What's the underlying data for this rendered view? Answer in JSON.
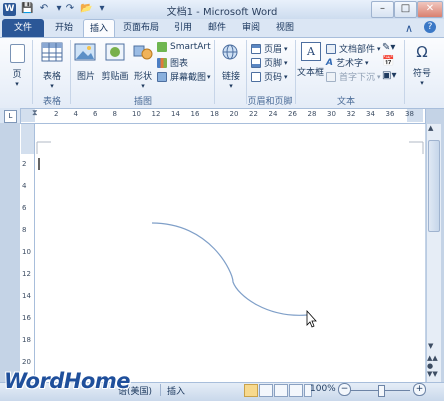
{
  "window": {
    "title": "文档1 - Microsoft Word",
    "controls": [
      "minimize",
      "maximize",
      "close"
    ]
  },
  "quick_access": [
    "save-icon",
    "undo-icon",
    "redo-icon",
    "open-icon"
  ],
  "tabs": [
    {
      "label": "文件"
    },
    {
      "label": "开始"
    },
    {
      "label": "插入"
    },
    {
      "label": "页面布局"
    },
    {
      "label": "引用"
    },
    {
      "label": "邮件"
    },
    {
      "label": "审阅"
    },
    {
      "label": "视图"
    }
  ],
  "active_tab": "插入",
  "ribbon": {
    "pages": {
      "label": "页",
      "group": ""
    },
    "tables": {
      "label": "表格",
      "group": "表格"
    },
    "illustrations": {
      "group": "插图",
      "picture": "图片",
      "clipart": "剪贴画",
      "shapes": "形状",
      "smartart": "SmartArt",
      "chart": "图表",
      "screenshot": "屏幕截图"
    },
    "links": {
      "label": "链接"
    },
    "header_footer": {
      "group": "页眉和页脚",
      "header": "页眉",
      "footer": "页脚",
      "page_number": "页码"
    },
    "text": {
      "group": "文本",
      "textbox": "文本框",
      "quickparts": "文档部件",
      "wordart": "艺术字",
      "dropcap": "首字下沉"
    },
    "symbols": {
      "label": "符号"
    }
  },
  "ruler": {
    "numbers": [
      "2",
      "4",
      "6",
      "8",
      "10",
      "12",
      "14",
      "16",
      "18",
      "20",
      "22",
      "24",
      "26",
      "28",
      "30",
      "32",
      "34",
      "36",
      "38"
    ]
  },
  "vruler": {
    "numbers": [
      "2",
      "4",
      "6",
      "8",
      "10",
      "12",
      "14",
      "16",
      "18",
      "20"
    ]
  },
  "status": {
    "language": "语(美国)",
    "mode": "插入",
    "zoom": "100%"
  },
  "colors": {
    "file_tab": "#2b5797",
    "curve": "#7f9fc8",
    "watermark": "#1f4f9b"
  },
  "watermark": "WordHome"
}
